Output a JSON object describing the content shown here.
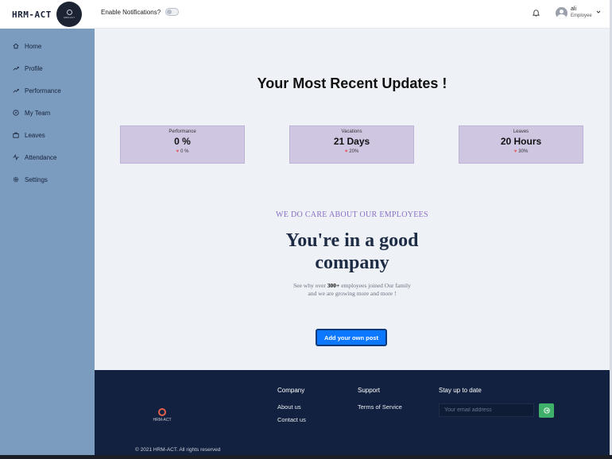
{
  "brand": {
    "name": "HRM-ACT",
    "logo_mini_text": "HRM-ACT"
  },
  "sidebar": {
    "items": [
      {
        "label": "Home",
        "icon": "home-icon"
      },
      {
        "label": "Profile",
        "icon": "trend-icon"
      },
      {
        "label": "Performance",
        "icon": "trend-icon"
      },
      {
        "label": "My Team",
        "icon": "compass-icon"
      },
      {
        "label": "Leaves",
        "icon": "briefcase-icon"
      },
      {
        "label": "Attendance",
        "icon": "activity-icon"
      },
      {
        "label": "Settings",
        "icon": "gear-icon"
      }
    ]
  },
  "header": {
    "notifications_label": "Enable Notifications?",
    "notifications_enabled": false,
    "user_name": "ali",
    "user_role": "Employee"
  },
  "main": {
    "title": "Your Most Recent Updates !",
    "cards": [
      {
        "label": "Performance",
        "value": "0 %",
        "trend": "0 %"
      },
      {
        "label": "Vacations",
        "value": "21 Days",
        "trend": "20%"
      },
      {
        "label": "Leaves",
        "value": "20 Hours",
        "trend": "30%"
      }
    ],
    "tagline": "WE DO CARE ABOUT OUR EMPLOYEES",
    "headline_line1": "You're in a good",
    "headline_line2": "company",
    "sub_prefix": "See why over ",
    "sub_bold": "300+",
    "sub_suffix": " employees joined Our family",
    "sub_line2": "and we are growing more and more !",
    "cta_label": "Add your own post"
  },
  "footer": {
    "logo_text": "HRM-ACT",
    "company_title": "Company",
    "company_links": [
      "About us",
      "Contact us"
    ],
    "support_title": "Support",
    "support_links": [
      "Terms of Service"
    ],
    "newsletter_title": "Stay up to date",
    "email_placeholder": "Your email address",
    "copyright": "© 2021 HRM-ACT. All rights reserved"
  },
  "colors": {
    "sidebar_bg": "#7b9cbf",
    "card_bg": "#cfc6e2",
    "tagline": "#8a6fc5",
    "cta_bg": "#0b78ff",
    "footer_bg": "#12213f",
    "send_button": "#3fb06a"
  }
}
